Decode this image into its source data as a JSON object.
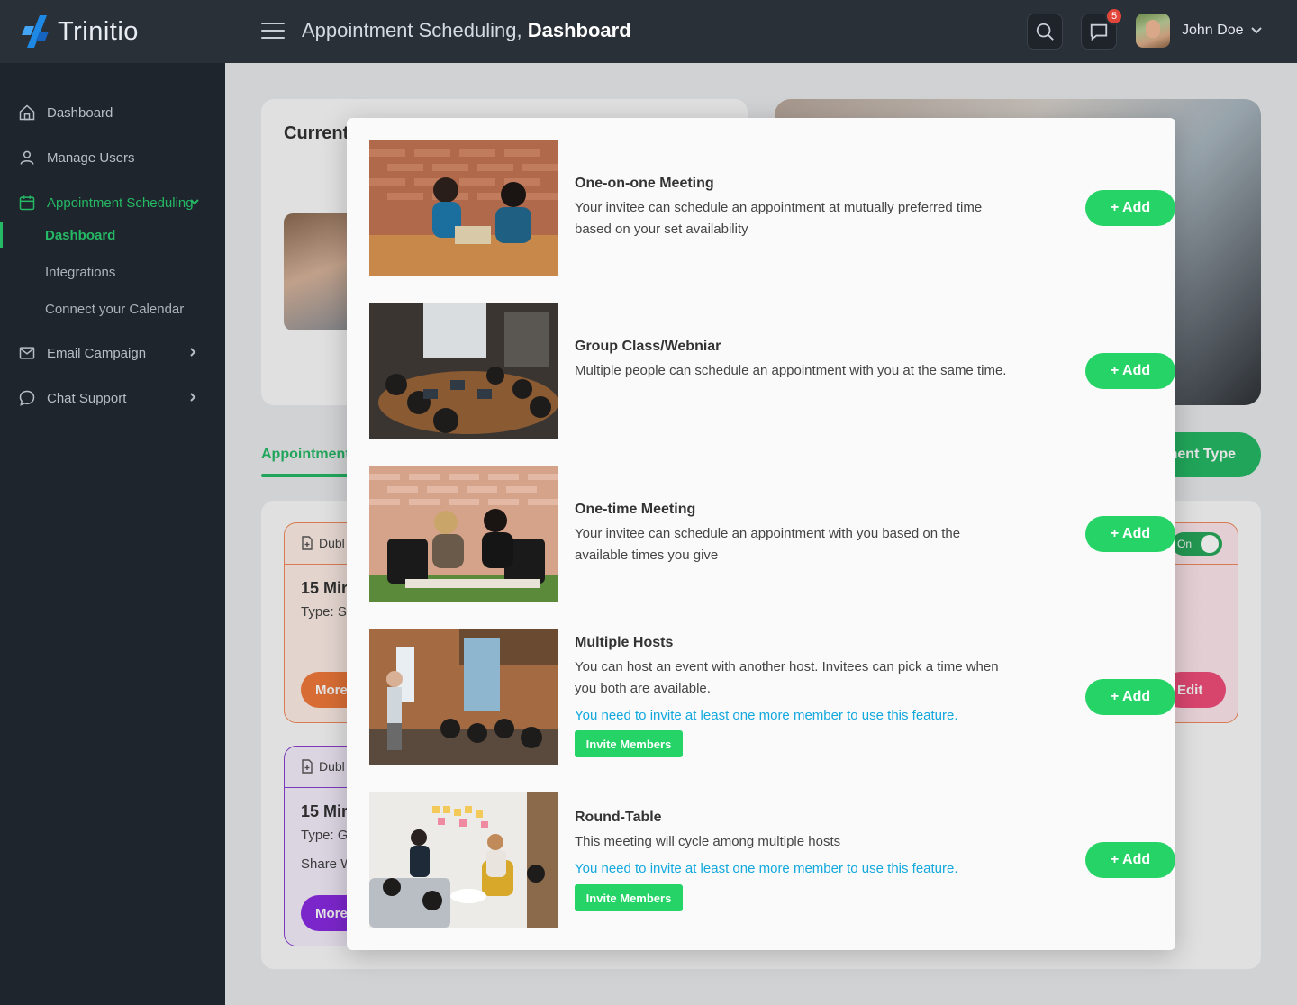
{
  "brand": {
    "name": "Trinitio"
  },
  "header": {
    "title_prefix": "Appointment Scheduling, ",
    "title_strong": "Dashboard",
    "notifications_count": "5",
    "user_name": "John Doe"
  },
  "sidebar": {
    "items": [
      {
        "label": "Dashboard"
      },
      {
        "label": "Manage Users"
      },
      {
        "label": "Appointment Scheduling"
      },
      {
        "label": "Email Campaign"
      },
      {
        "label": "Chat Support"
      }
    ],
    "sub_items": [
      {
        "label": "Dashboard"
      },
      {
        "label": "Integrations"
      },
      {
        "label": "Connect your Calendar"
      }
    ]
  },
  "background": {
    "current_title": "Current",
    "tab_label": "Appointment",
    "new_type_button": "nent Type",
    "card1": {
      "duplicate": "Dubl",
      "duration": "15 Mir",
      "type": "Type: S",
      "more": "More",
      "toggle": "On",
      "edit": "Edit"
    },
    "card2": {
      "duplicate": "Dubl",
      "duration": "15 Mir",
      "type": "Type: G",
      "share": "Share W",
      "more": "More"
    }
  },
  "modal": {
    "rows": [
      {
        "title": "One-on-one Meeting",
        "desc": "Your invitee can schedule an appointment at mutually preferred time based on your set availability",
        "add": "+ Add"
      },
      {
        "title": "Group Class/Webniar",
        "desc": "Multiple people can schedule an appointment with you at the same time.",
        "add": "+ Add"
      },
      {
        "title": "One-time Meeting",
        "desc": "Your invitee can schedule an appointment with you based on the available times you give",
        "add": "+ Add"
      },
      {
        "title": "Multiple Hosts",
        "desc": "You can host an event with another host. Invitees can pick a time when you both are available.",
        "note": "You need to invite at least one more member to use this feature.",
        "invite": "Invite Members",
        "add": "+ Add"
      },
      {
        "title": "Round-Table",
        "desc": "This meeting will cycle among multiple hosts",
        "note": "You need to invite at least one more member to use this feature.",
        "invite": "Invite Members",
        "add": "+ Add"
      }
    ]
  },
  "colors": {
    "accent": "#25d366",
    "active_nav": "#25b865",
    "link_note": "#12a8de",
    "topbar": "#2a3038",
    "sidebar": "#1f252c"
  }
}
